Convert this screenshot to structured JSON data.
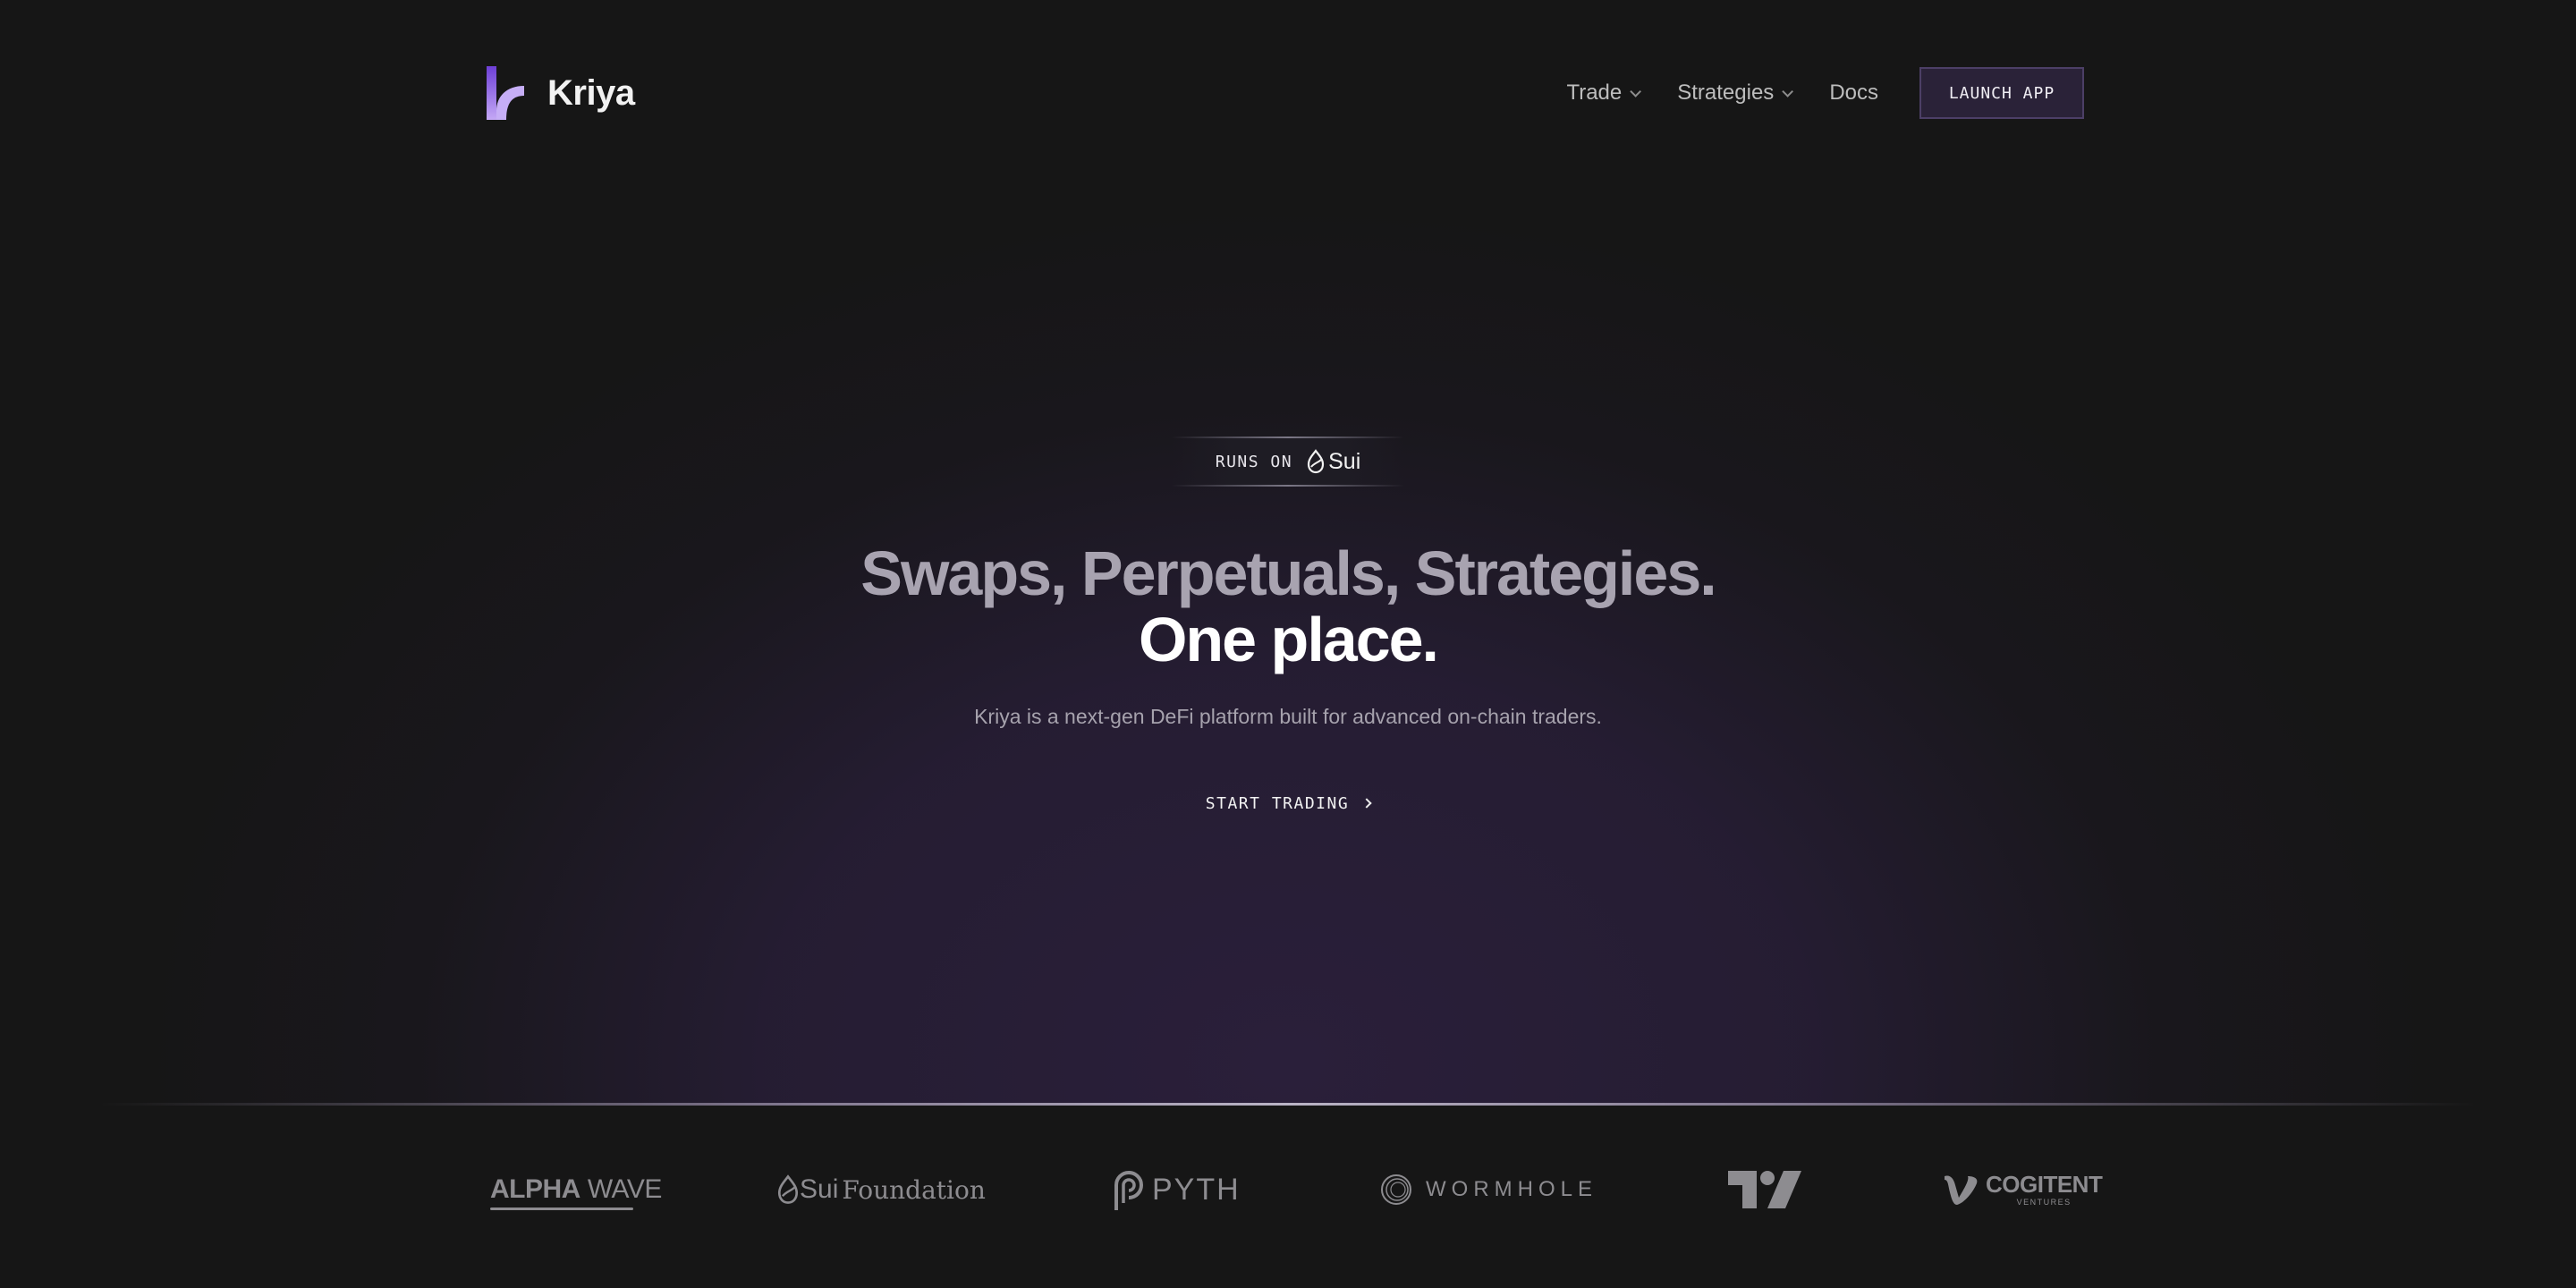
{
  "brand": {
    "name": "Kriya"
  },
  "nav": {
    "items": [
      {
        "label": "Trade",
        "has_dropdown": true
      },
      {
        "label": "Strategies",
        "has_dropdown": true
      },
      {
        "label": "Docs",
        "has_dropdown": false
      }
    ],
    "cta_label": "LAUNCH APP"
  },
  "hero": {
    "badge_prefix": "RUNS ON",
    "badge_chain": "Sui",
    "headline_line1": "Swaps, Perpetuals, Strategies.",
    "headline_line2": "One place.",
    "subtitle": "Kriya is a next-gen DeFi platform built for advanced on-chain traders.",
    "cta_label": "START TRADING"
  },
  "partners": {
    "alpha_wave": {
      "bold": "ALPHA",
      "light": "WAVE"
    },
    "sui_foundation": {
      "sui": "Sui",
      "rest": "Foundation"
    },
    "pyth": "PYTH",
    "wormhole": "WORMHOLE",
    "tradingview_icon": "tradingview-icon",
    "cogitent": {
      "main": "COGITENT",
      "sub": "VENTURES"
    }
  },
  "colors": {
    "background": "#161616",
    "accent_purple": "#8b5cf6",
    "button_bg": "#2a2238",
    "button_border": "#4c3f66",
    "headline_muted": "#a8a3b0",
    "partner_gray": "#8d8c90"
  }
}
